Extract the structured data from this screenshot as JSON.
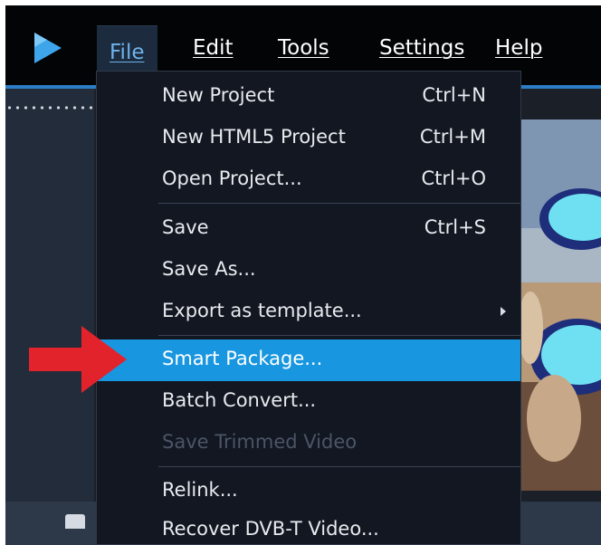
{
  "menubar": {
    "items": [
      {
        "label": "File",
        "active": true
      },
      {
        "label": "Edit"
      },
      {
        "label": "Tools"
      },
      {
        "label": "Settings"
      },
      {
        "label": "Help"
      }
    ]
  },
  "file_menu": {
    "items": [
      {
        "label": "New Project",
        "shortcut": "Ctrl+N"
      },
      {
        "label": "New HTML5 Project",
        "shortcut": "Ctrl+M"
      },
      {
        "label": "Open Project...",
        "shortcut": "Ctrl+O"
      },
      {
        "label": "Save",
        "shortcut": "Ctrl+S"
      },
      {
        "label": "Save As..."
      },
      {
        "label": "Export as template...",
        "has_submenu": true
      },
      {
        "label": "Smart Package...",
        "highlighted": true
      },
      {
        "label": "Batch Convert..."
      },
      {
        "label": "Save Trimmed Video",
        "disabled": true
      },
      {
        "label": "Relink..."
      },
      {
        "label": "Recover DVB-T Video..."
      }
    ]
  },
  "colors": {
    "menu_background": "#121722",
    "highlight": "#1896e0",
    "accent_line": "#2b7ec6",
    "annotation_arrow": "#e3232b",
    "disabled_text": "#4c5566"
  }
}
